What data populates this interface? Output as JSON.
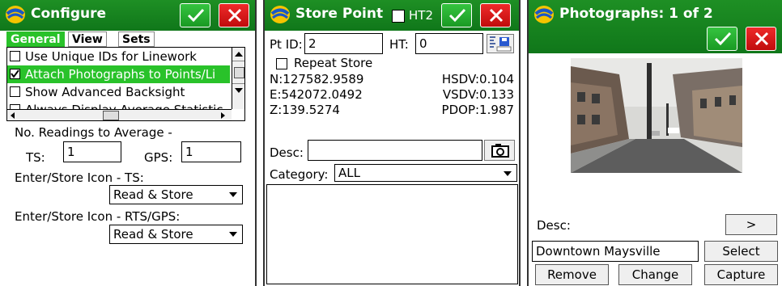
{
  "configure": {
    "title": "Configure",
    "tabs": [
      "General",
      "View",
      "Sets"
    ],
    "options": [
      {
        "label": "Use Unique IDs for Linework",
        "checked": false
      },
      {
        "label": "Attach Photographs to Points/Li",
        "checked": true
      },
      {
        "label": "Show Advanced Backsight",
        "checked": false
      },
      {
        "label": "Always Display Average Statistic",
        "checked": false
      }
    ],
    "readings_label": "No. Readings to Average -",
    "ts_label": "TS:",
    "ts_value": "1",
    "gps_label": "GPS:",
    "gps_value": "1",
    "icon_ts_label": "Enter/Store Icon - TS:",
    "icon_ts_value": "Read & Store",
    "icon_rts_label": "Enter/Store Icon - RTS/GPS:",
    "icon_rts_value": "Read & Store"
  },
  "store_point": {
    "title": "Store Point",
    "ht2_label": "HT2",
    "pt_id_label": "Pt ID:",
    "pt_id_value": "2",
    "ht_label": "HT:",
    "ht_value": "0",
    "repeat_label": "Repeat Store",
    "n_value": "N:127582.9589",
    "e_value": "E:542072.0492",
    "z_value": "Z:139.5274",
    "hsdv": "HSDV:0.104",
    "vsdv": "VSDV:0.133",
    "pdop": "PDOP:1.987",
    "desc_label": "Desc:",
    "desc_value": "",
    "category_label": "Category:",
    "category_value": "ALL"
  },
  "photographs": {
    "title": "Photographs: 1 of 2",
    "desc_label": "Desc:",
    "next_label": ">",
    "desc_value": "Downtown Maysville",
    "select_label": "Select",
    "remove_label": "Remove",
    "change_label": "Change",
    "capture_label": "Capture"
  },
  "colors": {
    "titlebar": "#14801c",
    "ok": "#22a82c",
    "cancel": "#d81616",
    "selection": "#29c22a"
  }
}
